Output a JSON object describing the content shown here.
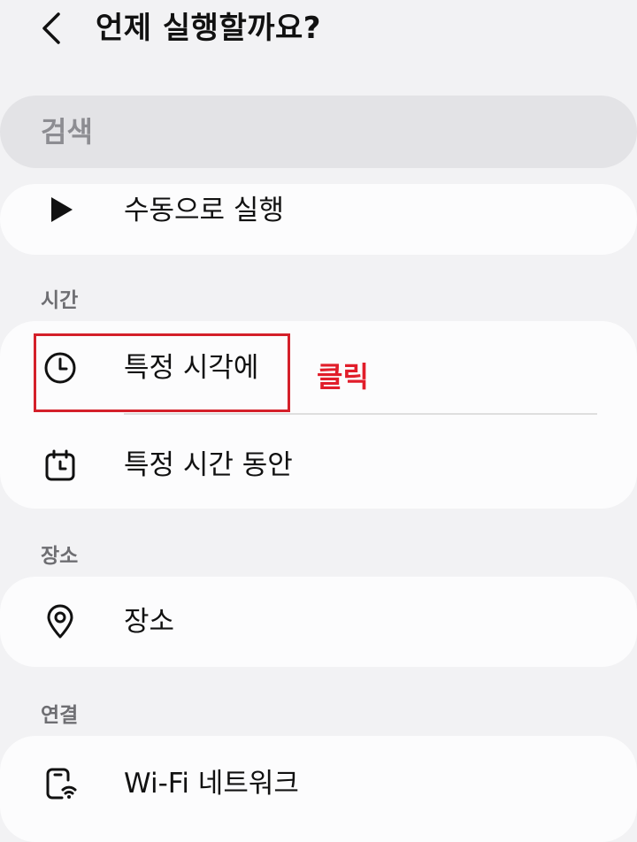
{
  "header": {
    "title": "언제 실행할까요?",
    "back_icon": "chevron-left-icon"
  },
  "search": {
    "placeholder": "검색"
  },
  "manual": {
    "label": "수동으로 실행",
    "icon": "play-icon"
  },
  "sections": {
    "time": {
      "title": "시간",
      "items": [
        {
          "label": "특정 시각에",
          "icon": "clock-icon"
        },
        {
          "label": "특정 시간 동안",
          "icon": "calendar-clock-icon"
        }
      ]
    },
    "place": {
      "title": "장소",
      "items": [
        {
          "label": "장소",
          "icon": "location-pin-icon"
        }
      ]
    },
    "connection": {
      "title": "연결",
      "items": [
        {
          "label": "Wi-Fi 네트워크",
          "icon": "wifi-phone-icon"
        }
      ]
    }
  },
  "annotation": {
    "text": "클릭",
    "color": "#e11d2a"
  },
  "colors": {
    "background": "#f2f2f4",
    "card": "#fcfcfd",
    "search_bg": "#e3e3e6",
    "highlight_border": "#d4202a"
  }
}
